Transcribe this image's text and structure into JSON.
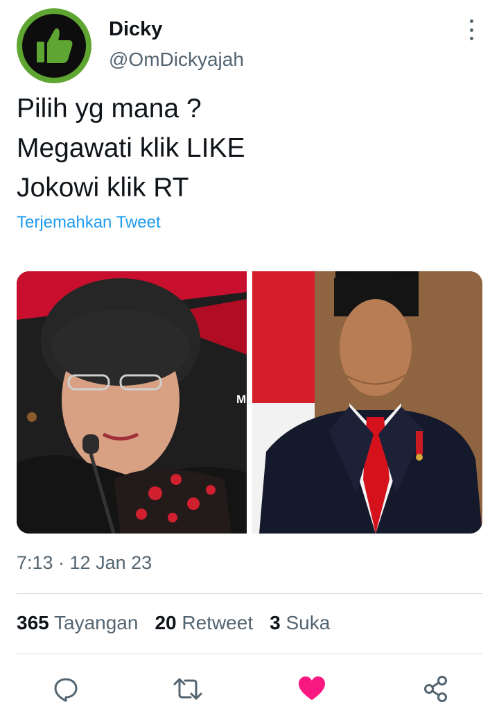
{
  "user": {
    "display_name": "Dicky",
    "handle": "@OmDickyajah",
    "avatar_icon": "thumbs-up-icon",
    "avatar_colors": {
      "ring": "#5fa532",
      "inner": "#0d0d0d",
      "thumb": "#5fa532"
    }
  },
  "tweet": {
    "lines": [
      "Pilih yg mana ?",
      "Megawati klik LIKE",
      "Jokowi klik RT"
    ],
    "translate_label": "Terjemahkan Tweet",
    "timestamp": "7:13 · 12 Jan 23"
  },
  "media": {
    "left_photo_overlay_text": "M"
  },
  "stats": {
    "views_count": "365",
    "views_label": "Tayangan",
    "retweets_count": "20",
    "retweets_label": "Retweet",
    "likes_count": "3",
    "likes_label": "Suka"
  },
  "actions": {
    "reply_icon": "reply-icon",
    "retweet_icon": "retweet-icon",
    "like_icon": "heart-icon",
    "share_icon": "share-icon",
    "like_color": "#f91880",
    "icon_color": "#536471"
  }
}
